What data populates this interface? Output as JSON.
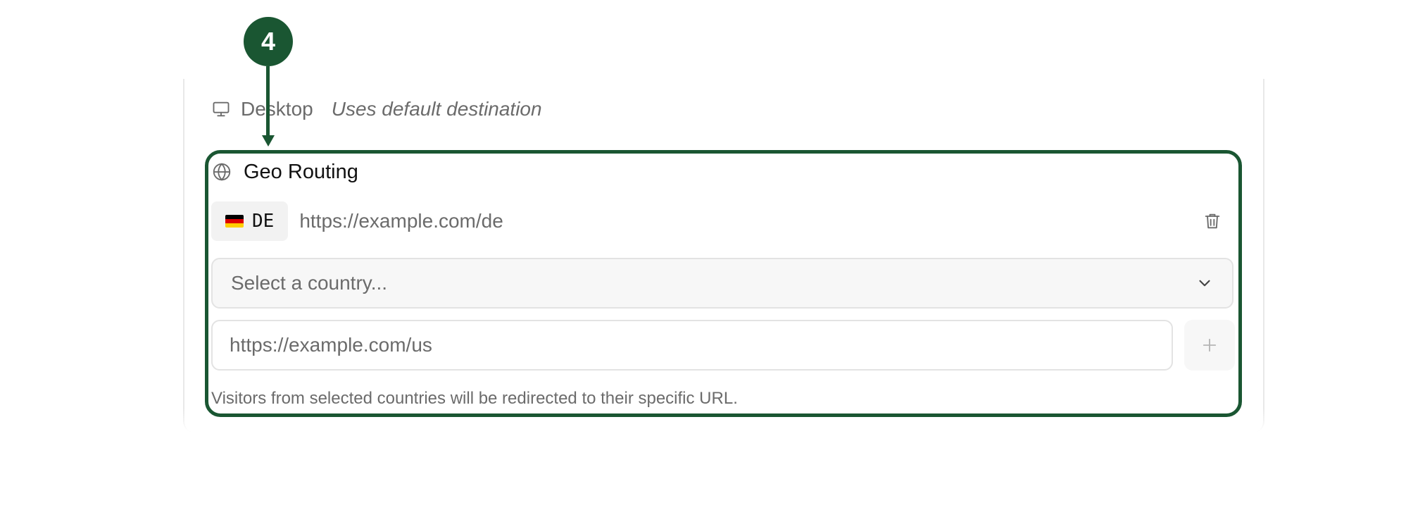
{
  "annotation": {
    "step_number": "4",
    "color": "#1a5632"
  },
  "desktop": {
    "icon": "monitor-icon",
    "label": "Desktop",
    "note": "Uses default destination"
  },
  "geo_routing": {
    "icon": "globe-icon",
    "title": "Geo Routing",
    "entries": [
      {
        "flag": "de-flag-icon",
        "code": "DE",
        "url": "https://example.com/de",
        "delete_icon": "trash-icon"
      }
    ],
    "country_select": {
      "placeholder": "Select a country...",
      "icon": "chevron-down-icon"
    },
    "url_input": {
      "placeholder": "https://example.com/us",
      "value": ""
    },
    "add_button": {
      "icon": "plus-icon"
    },
    "help_text": "Visitors from selected countries will be redirected to their specific URL."
  }
}
